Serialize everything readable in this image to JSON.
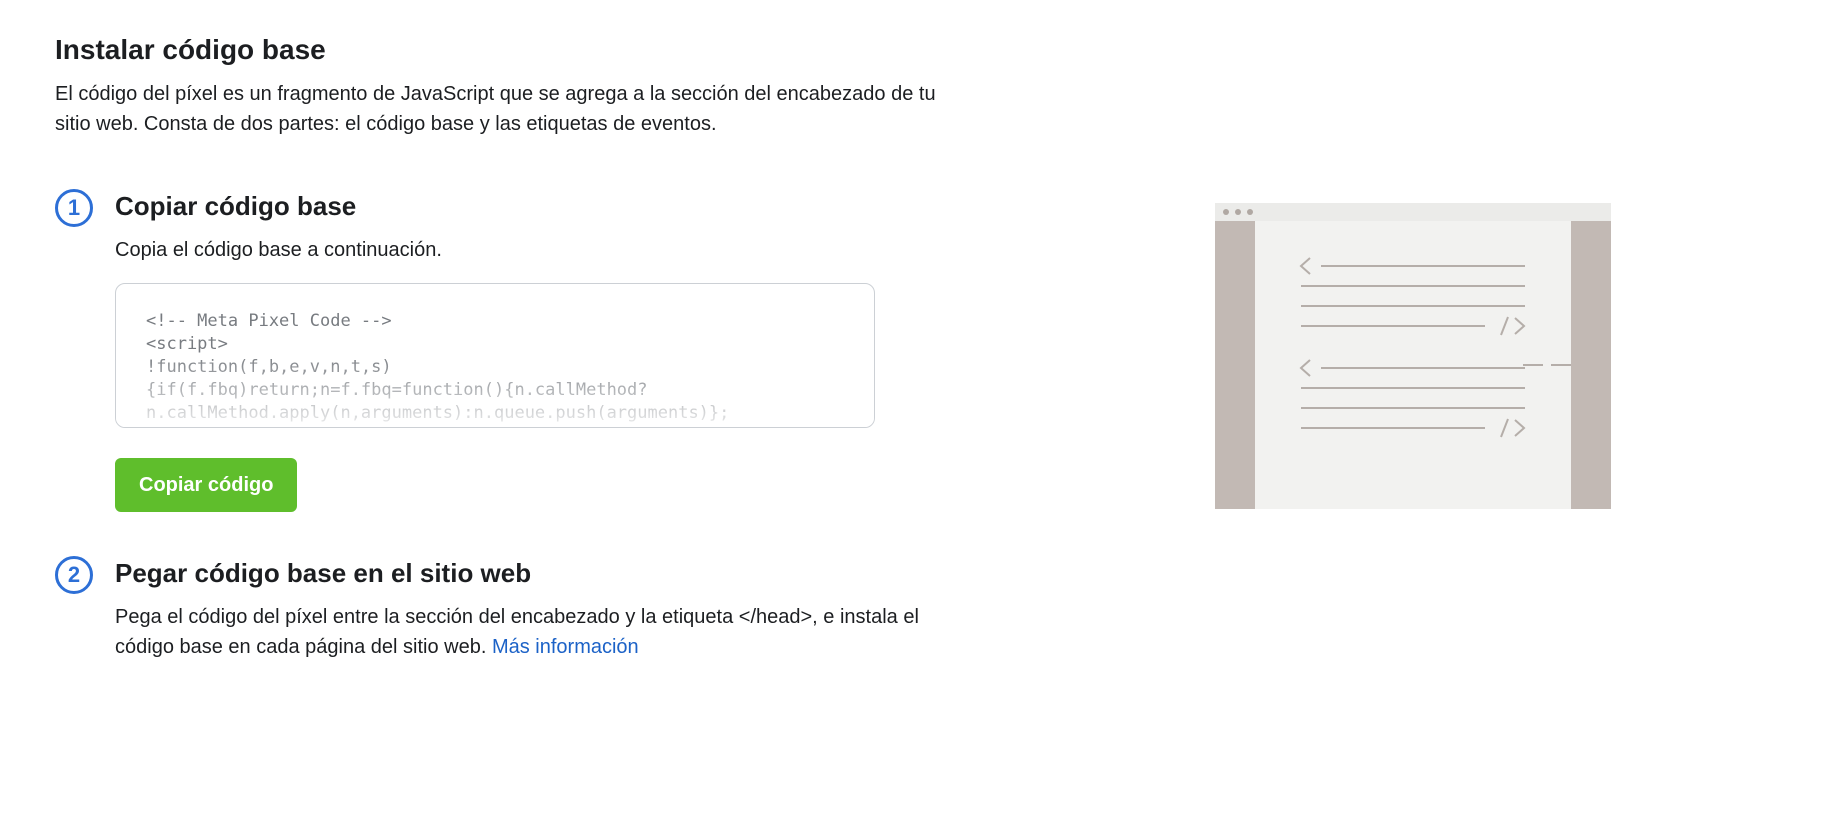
{
  "header": {
    "title": "Instalar código base",
    "intro": "El código del píxel es un fragmento de JavaScript que se agrega a la sección del encabezado de tu sitio web. Consta de dos partes: el código base y las etiquetas de eventos."
  },
  "steps": [
    {
      "number": "1",
      "title": "Copiar código base",
      "description": "Copia el código base a continuación.",
      "code_lines": [
        "<!-- Meta Pixel Code -->",
        "<script>",
        "!function(f,b,e,v,n,t,s)",
        "{if(f.fbq)return;n=f.fbq=function(){n.callMethod?",
        "n.callMethod.apply(n,arguments):n.queue.push(arguments)};"
      ],
      "button_label": "Copiar código"
    },
    {
      "number": "2",
      "title": "Pegar código base en el sitio web",
      "description": "Pega el código del píxel entre la sección del encabezado y la etiqueta </head>, e instala el código base en cada página del sitio web.",
      "link_label": "Más información"
    }
  ],
  "colors": {
    "step_accent": "#2d6fd6",
    "button_green": "#5fbe2c",
    "link_blue": "#1c62c7",
    "illustration_frame": "#c2b9b4",
    "illustration_page": "#f2f2f0"
  },
  "illustration": {
    "icon": "browser-code-illustration"
  }
}
